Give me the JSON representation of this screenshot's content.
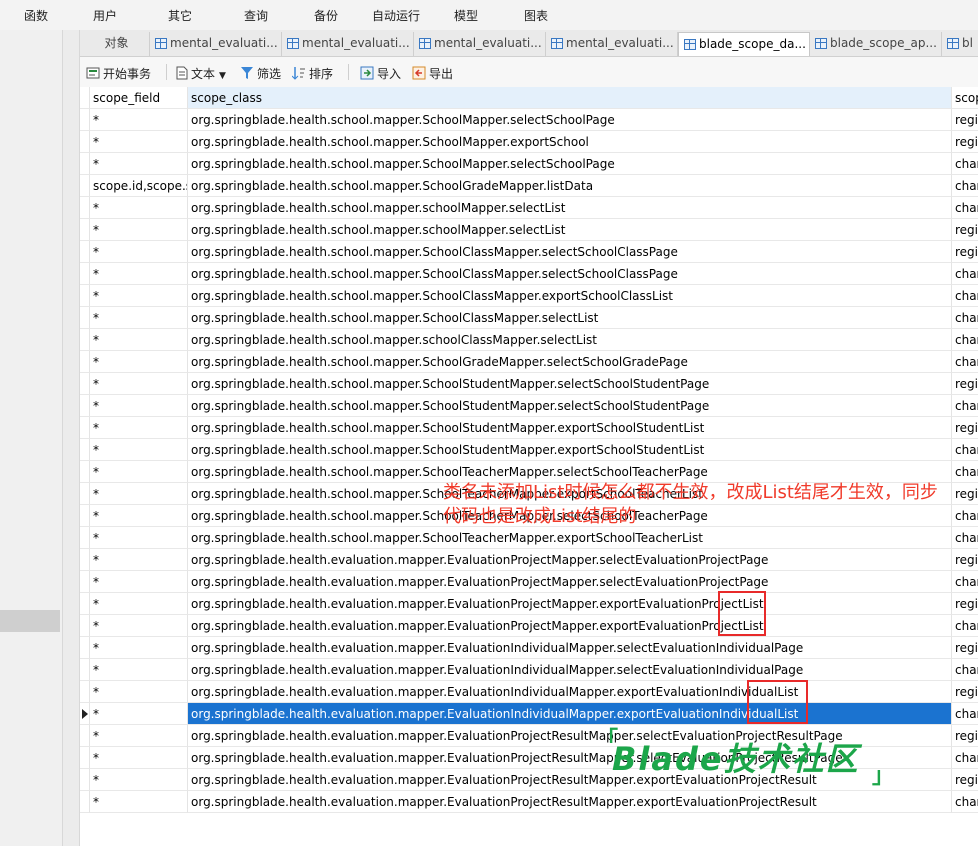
{
  "menu": [
    "函数",
    "用户",
    "其它",
    "查询",
    "备份",
    "自动运行",
    "模型",
    "图表"
  ],
  "tabs": [
    {
      "label": "对象",
      "icon": "none"
    },
    {
      "label": "mental_evaluati...",
      "icon": "table-icon"
    },
    {
      "label": "mental_evaluati...",
      "icon": "table-icon"
    },
    {
      "label": "mental_evaluati...",
      "icon": "table-icon"
    },
    {
      "label": "mental_evaluati...",
      "icon": "table-icon"
    },
    {
      "label": "blade_scope_da...",
      "icon": "table-icon"
    },
    {
      "label": "blade_scope_ap...",
      "icon": "table-icon"
    },
    {
      "label": "bl",
      "icon": "table-icon"
    }
  ],
  "toolbar": {
    "begin_transaction": "开始事务",
    "text": "文本",
    "filter": "筛选",
    "sort": "排序",
    "import": "导入",
    "export": "导出"
  },
  "grid": {
    "headers": [
      "scope_field",
      "scope_class",
      "scop"
    ],
    "rows": [
      {
        "field": "*",
        "class": "org.springblade.health.school.mapper.SchoolMapper.selectSchoolPage",
        "extra": "regi"
      },
      {
        "field": "*",
        "class": "org.springblade.health.school.mapper.SchoolMapper.exportSchool",
        "extra": "regi"
      },
      {
        "field": "*",
        "class": "org.springblade.health.school.mapper.SchoolMapper.selectSchoolPage",
        "extra": "char"
      },
      {
        "field": "scope.id,scope.s",
        "class": "org.springblade.health.school.mapper.SchoolGradeMapper.listData",
        "extra": "char"
      },
      {
        "field": "*",
        "class": "org.springblade.health.school.mapper.schoolMapper.selectList",
        "extra": "char"
      },
      {
        "field": "*",
        "class": "org.springblade.health.school.mapper.schoolMapper.selectList",
        "extra": "regi"
      },
      {
        "field": "*",
        "class": "org.springblade.health.school.mapper.SchoolClassMapper.selectSchoolClassPage",
        "extra": "regi"
      },
      {
        "field": "*",
        "class": "org.springblade.health.school.mapper.SchoolClassMapper.selectSchoolClassPage",
        "extra": "char"
      },
      {
        "field": "*",
        "class": "org.springblade.health.school.mapper.SchoolClassMapper.exportSchoolClassList",
        "extra": "char"
      },
      {
        "field": "*",
        "class": "org.springblade.health.school.mapper.SchoolClassMapper.selectList",
        "extra": "char"
      },
      {
        "field": "*",
        "class": "org.springblade.health.school.mapper.schoolClassMapper.selectList",
        "extra": "char"
      },
      {
        "field": "*",
        "class": "org.springblade.health.school.mapper.SchoolGradeMapper.selectSchoolGradePage",
        "extra": "char"
      },
      {
        "field": "*",
        "class": "org.springblade.health.school.mapper.SchoolStudentMapper.selectSchoolStudentPage",
        "extra": "regi"
      },
      {
        "field": "*",
        "class": "org.springblade.health.school.mapper.SchoolStudentMapper.selectSchoolStudentPage",
        "extra": "char"
      },
      {
        "field": "*",
        "class": "org.springblade.health.school.mapper.SchoolStudentMapper.exportSchoolStudentList",
        "extra": "regi"
      },
      {
        "field": "*",
        "class": "org.springblade.health.school.mapper.SchoolStudentMapper.exportSchoolStudentList",
        "extra": "char"
      },
      {
        "field": "*",
        "class": "org.springblade.health.school.mapper.SchoolTeacherMapper.selectSchoolTeacherPage",
        "extra": "char"
      },
      {
        "field": "*",
        "class": "org.springblade.health.school.mapper.SchoolTeacherMapper.exportSchoolTeacherList",
        "extra": "regi"
      },
      {
        "field": "*",
        "class": "org.springblade.health.school.mapper.SchoolTeacherMapper.selectSchoolTeacherPage",
        "extra": "char"
      },
      {
        "field": "*",
        "class": "org.springblade.health.school.mapper.SchoolTeacherMapper.exportSchoolTeacherList",
        "extra": "char"
      },
      {
        "field": "*",
        "class": "org.springblade.health.evaluation.mapper.EvaluationProjectMapper.selectEvaluationProjectPage",
        "extra": "regi"
      },
      {
        "field": "*",
        "class": "org.springblade.health.evaluation.mapper.EvaluationProjectMapper.selectEvaluationProjectPage",
        "extra": "char"
      },
      {
        "field": "*",
        "class": "org.springblade.health.evaluation.mapper.EvaluationProjectMapper.exportEvaluationProjectList",
        "extra": "regi"
      },
      {
        "field": "*",
        "class": "org.springblade.health.evaluation.mapper.EvaluationProjectMapper.exportEvaluationProjectList",
        "extra": "char"
      },
      {
        "field": "*",
        "class": "org.springblade.health.evaluation.mapper.EvaluationIndividualMapper.selectEvaluationIndividualPage",
        "extra": "regi"
      },
      {
        "field": "*",
        "class": "org.springblade.health.evaluation.mapper.EvaluationIndividualMapper.selectEvaluationIndividualPage",
        "extra": "char"
      },
      {
        "field": "*",
        "class": "org.springblade.health.evaluation.mapper.EvaluationIndividualMapper.exportEvaluationIndividualList",
        "extra": "regi"
      },
      {
        "field": "*",
        "class": "org.springblade.health.evaluation.mapper.EvaluationIndividualMapper.exportEvaluationIndividualList",
        "extra": "char",
        "selected": true
      },
      {
        "field": "*",
        "class": "org.springblade.health.evaluation.mapper.EvaluationProjectResultMapper.selectEvaluationProjectResultPage",
        "extra": "regi"
      },
      {
        "field": "*",
        "class": "org.springblade.health.evaluation.mapper.EvaluationProjectResultMapper.selectEvaluationProjectResultPage",
        "extra": "char"
      },
      {
        "field": "*",
        "class": "org.springblade.health.evaluation.mapper.EvaluationProjectResultMapper.exportEvaluationProjectResult",
        "extra": "regi"
      },
      {
        "field": "*",
        "class": "org.springblade.health.evaluation.mapper.EvaluationProjectResultMapper.exportEvaluationProjectResult",
        "extra": "char"
      }
    ]
  },
  "annotation": "类名未添加List时候怎么都不生效，改成List结尾才生效，同步代码也是改成List结尾的",
  "watermark": "Blade技术社区",
  "watermark_brackets": [
    "「",
    "」"
  ],
  "colors": {
    "selected_row": "#1b73d0",
    "annotation": "#f03a2a",
    "watermark": "#1ca64a",
    "header_highlight": "#e4f0fb"
  }
}
